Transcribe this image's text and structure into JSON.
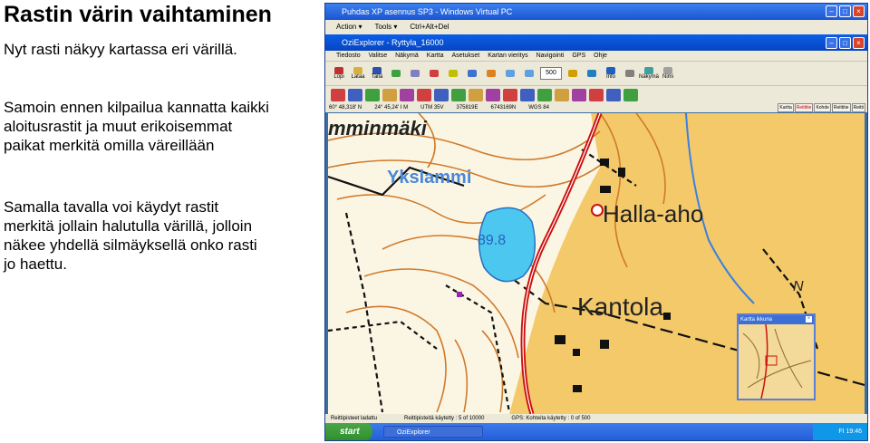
{
  "slide": {
    "title": "Rastin värin vaihtaminen",
    "para1": "Nyt rasti näkyy kartassa eri värillä.",
    "para2": "Samoin ennen kilpailua kannatta kaikki\naloitusrastit ja muut erikoisemmat\npaikat merkitä omilla väreillään",
    "para3": "Samalla tavalla voi käydyt rastit\nmerkitä jollain halutulla värillä, jolloin\nnäkee yhdellä silmäyksellä onko rasti\njo haettu."
  },
  "vm": {
    "title": "Puhdas XP asennus SP3 - Windows Virtual PC",
    "menu": [
      "Action ▾",
      "Tools ▾",
      "Ctrl+Alt+Del"
    ]
  },
  "ozi": {
    "title": "OziExplorer - Ryttyla_16000",
    "menu": [
      "Tiedosto",
      "Valitse",
      "Näkymä",
      "Kartta",
      "Asetukset",
      "Kartan vieritys",
      "Navigointi",
      "GPS",
      "Ohje"
    ],
    "toolbar1": [
      "Lopi",
      "Lataa",
      "Tallä",
      "",
      "",
      "",
      "",
      "",
      "",
      "",
      "",
      "",
      "",
      "Info",
      "",
      "Näkymä",
      "Nimi"
    ],
    "zoom": "500",
    "coords": [
      "60° 48,318' N",
      "24° 45,24' I  M",
      "UTM 35V",
      "375819E",
      "6743169N",
      "WGS 84"
    ],
    "coord_buttons": [
      "Kartta",
      "Reittitie",
      "Kohde",
      "Reittitie",
      "Reitti"
    ]
  },
  "map": {
    "labels": [
      "mminmäki",
      "Ykslammi",
      "89.8",
      "Halla-aho",
      "Kantola",
      "N"
    ],
    "minimap_title": "Kartta ikkuna"
  },
  "status": [
    "Reittipisteet ladattu",
    "Reittipisteitä käytetty : 5 of 10000",
    "GPS: Kohteita käytetty : 0 of 500"
  ],
  "taskbar": {
    "start": "start",
    "task": "OziExplorer",
    "clock": "FI  19:46"
  },
  "colors": {
    "road": "#cc1010",
    "lake": "#4cc8f0",
    "field": "#f3c96a",
    "contour": "#d07a2a"
  }
}
